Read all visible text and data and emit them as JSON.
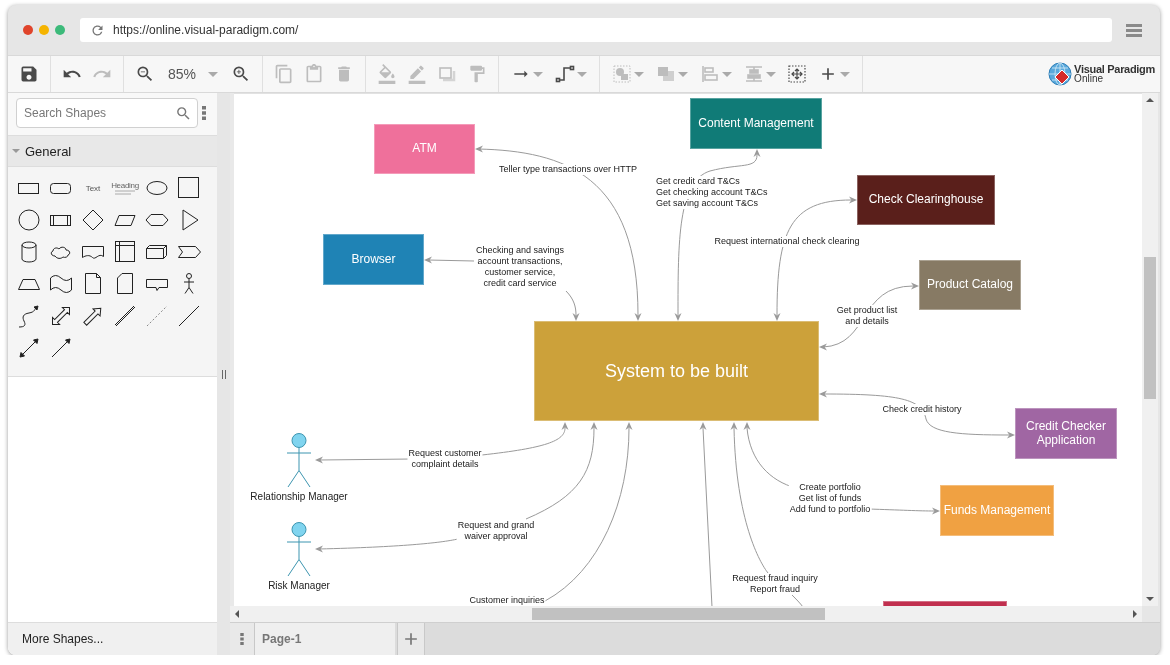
{
  "browser": {
    "url": "https://online.visual-paradigm.com/"
  },
  "toolbar": {
    "buttons": [
      {
        "disabled": false
      },
      {
        "disabled": false
      },
      {
        "disabled": true
      },
      {
        "disabled": false
      },
      {
        "disabled": false
      },
      {
        "disabled": true
      },
      {
        "disabled": true
      },
      {
        "disabled": true
      },
      {
        "disabled": true
      },
      {
        "disabled": true
      },
      {
        "disabled": true
      },
      {
        "disabled": true
      },
      {
        "disabled": false
      },
      {
        "disabled": false
      },
      {
        "disabled": true
      },
      {
        "disabled": true
      },
      {
        "disabled": true
      },
      {
        "disabled": true
      },
      {
        "disabled": false
      },
      {
        "disabled": false
      }
    ],
    "zoom_level": "85%"
  },
  "logo": {
    "title": "Visual Paradigm",
    "subtitle": "Online"
  },
  "sidebar": {
    "search": {
      "placeholder": "Search Shapes"
    },
    "category": {
      "title": "General",
      "expanded": true,
      "text_samples": [
        "Text",
        "Heading"
      ]
    },
    "more_button": "More Shapes..."
  },
  "diagram": {
    "nodes": [
      {
        "kind": "box",
        "label": "Content Management",
        "color": "#107b77"
      },
      {
        "kind": "box",
        "label": "ATM",
        "color": "#ef709b"
      },
      {
        "kind": "box",
        "label": "Check Clearinghouse",
        "color": "#5a1f1b"
      },
      {
        "kind": "box",
        "label": "Browser",
        "color": "#1f83b5"
      },
      {
        "kind": "box",
        "label": "Product Catalog",
        "color": "#877a64"
      },
      {
        "kind": "box",
        "label": "System to be built",
        "color": "#cca13a"
      },
      {
        "kind": "box",
        "label": "Credit Checker Application",
        "color": "#a066a3"
      },
      {
        "kind": "actor",
        "label": "Relationship Manager"
      },
      {
        "kind": "box",
        "label": "Funds Management",
        "color": "#f0a142"
      },
      {
        "kind": "actor",
        "label": "Risk Manager"
      },
      {
        "kind": "box",
        "color": "#c1304f"
      }
    ],
    "connectors": [
      {
        "label": "Teller type transactions over HTTP"
      },
      {
        "label": "Get credit card T&Cs\nGet checking account T&Cs\nGet saving account T&Cs"
      },
      {
        "label": "Request international check clearing"
      },
      {
        "label": "Checking and savings\naccount transactions,\ncustomer service,\ncredit card service"
      },
      {
        "label": "Get product list\nand details"
      },
      {
        "label": "Check credit history"
      },
      {
        "label": "Request customer\ncomplaint details"
      },
      {
        "label": "Create portfolio\nGet list of funds\nAdd fund to portfolio"
      },
      {
        "label": "Request and grand\nwaiver approval"
      },
      {
        "label": "Request fraud inquiry\nReport fraud"
      },
      {
        "label": "Customer inquiries"
      }
    ]
  },
  "pages": [
    {
      "label": "Page-1",
      "selected": true
    }
  ]
}
